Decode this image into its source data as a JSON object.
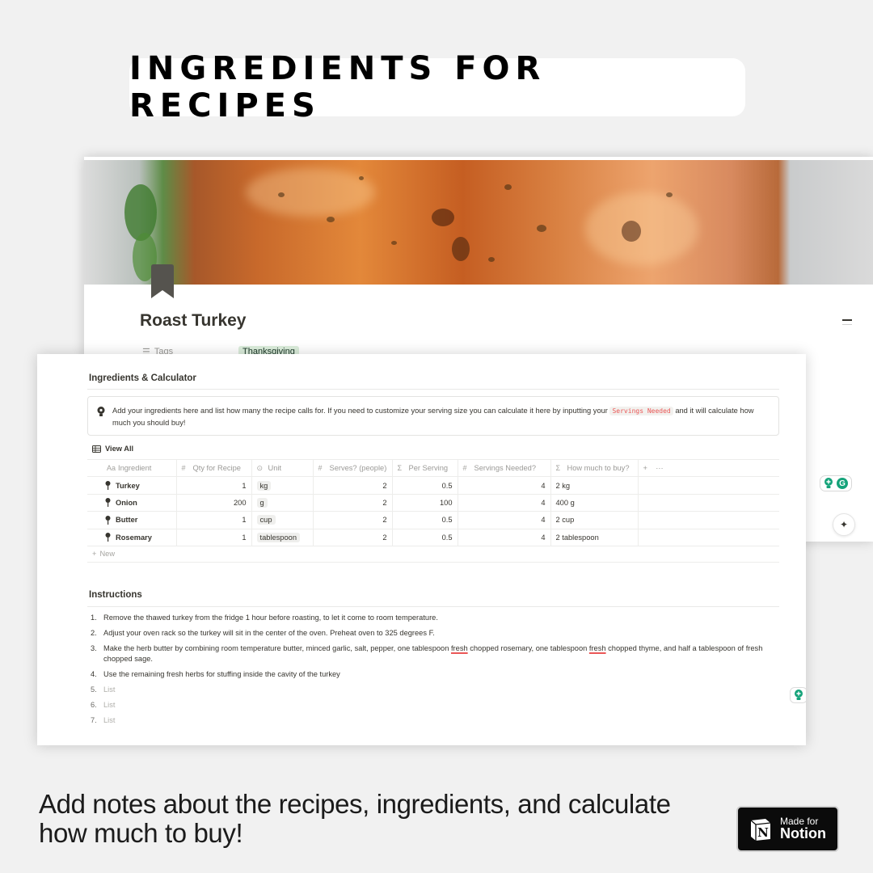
{
  "headline": "INGREDIENTS FOR RECIPES",
  "page": {
    "title": "Roast Turkey",
    "icon": "bookmark-icon",
    "cover": "roast-turkey-photo",
    "properties": [
      {
        "label": "Tags",
        "icon": "list-icon",
        "value": "Thanksgiving",
        "color": "#dbeddb"
      }
    ]
  },
  "ingredients_section": {
    "heading": "Ingredients & Calculator",
    "callout": {
      "icon": "lightbulb-icon",
      "text_before": "Add your ingredients here and list how many the recipe calls for. If you need to customize your serving size you can calculate it here by inputting your ",
      "code": "Servings Needed",
      "text_after": " and it will calculate how much you should buy!"
    },
    "view_tab": {
      "icon": "table-icon",
      "label": "View All"
    },
    "table": {
      "columns": [
        {
          "icon": "Aa",
          "label": "Ingredient"
        },
        {
          "icon": "#",
          "label": "Qty for Recipe"
        },
        {
          "icon": "select-icon",
          "label": "Unit"
        },
        {
          "icon": "#",
          "label": "Serves? (people)"
        },
        {
          "icon": "Σ",
          "label": "Per Serving"
        },
        {
          "icon": "#",
          "label": "Servings Needed?"
        },
        {
          "icon": "Σ",
          "label": "How much to buy?"
        }
      ],
      "add_column": "+",
      "more": "···",
      "rows": [
        {
          "ingredient": "Turkey",
          "qty": "1",
          "unit": "kg",
          "serves": "2",
          "per_serving": "0.5",
          "servings_needed": "4",
          "to_buy": "2 kg"
        },
        {
          "ingredient": "Onion",
          "qty": "200",
          "unit": "g",
          "serves": "2",
          "per_serving": "100",
          "servings_needed": "4",
          "to_buy": "400 g"
        },
        {
          "ingredient": "Butter",
          "qty": "1",
          "unit": "cup",
          "serves": "2",
          "per_serving": "0.5",
          "servings_needed": "4",
          "to_buy": "2 cup"
        },
        {
          "ingredient": "Rosemary",
          "qty": "1",
          "unit": "tablespoon",
          "serves": "2",
          "per_serving": "0.5",
          "servings_needed": "4",
          "to_buy": "2 tablespoon"
        }
      ],
      "new_label": "New"
    }
  },
  "instructions_section": {
    "heading": "Instructions",
    "steps": [
      {
        "n": "1.",
        "text": "Remove the thawed turkey from the fridge 1 hour before roasting, to let it come to room temperature."
      },
      {
        "n": "2.",
        "text": "Adjust your oven rack so the turkey will sit in the center of the oven. Preheat oven to 325 degrees F."
      },
      {
        "n": "3.",
        "parts": [
          "Make the herb butter by combining room temperature butter, minced garlic, salt, pepper, one tablespoon ",
          "fresh",
          " chopped rosemary, one tablespoon ",
          "fresh",
          " chopped thyme, and half a tablespoon of fresh chopped sage."
        ]
      },
      {
        "n": "4.",
        "text": "Use the remaining fresh herbs for stuffing inside the cavity of the turkey"
      },
      {
        "n": "5.",
        "text": "List",
        "placeholder": true
      },
      {
        "n": "6.",
        "text": "List",
        "placeholder": true
      },
      {
        "n": "7.",
        "text": "List",
        "placeholder": true
      }
    ]
  },
  "widgets": {
    "grammarly": "G",
    "ai_button": "sparkle-icon"
  },
  "caption": "Add notes about the recipes, ingredients, and calculate how much to buy!",
  "badge": {
    "small": "Made for",
    "big": "Notion",
    "logo": "N"
  }
}
